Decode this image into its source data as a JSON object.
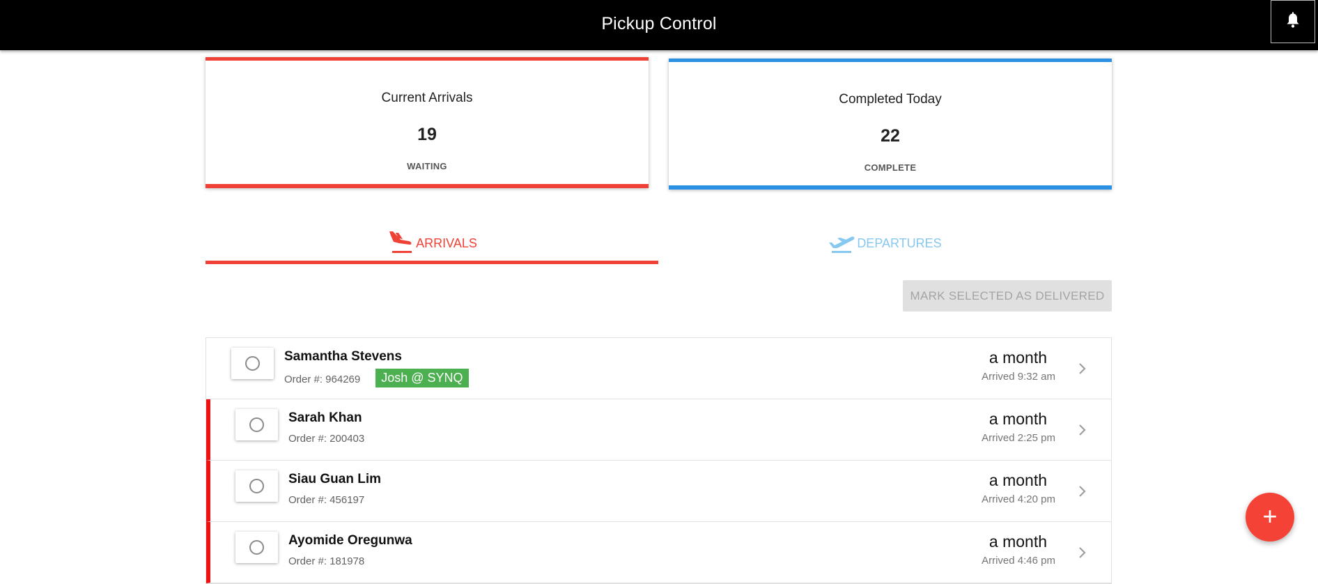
{
  "header": {
    "title": "Pickup Control",
    "notification_icon": "bell-icon"
  },
  "stats": {
    "arrivals": {
      "title": "Current Arrivals",
      "count": "19",
      "status": "WAITING",
      "accent": "#ef4136"
    },
    "completed": {
      "title": "Completed Today",
      "count": "22",
      "status": "COMPLETE",
      "accent": "#2b8fe2"
    }
  },
  "tabs": {
    "arrivals": {
      "label": "ARRIVALS",
      "icon": "plane-landing-icon",
      "active": true,
      "color": "#ef4136"
    },
    "departures": {
      "label": "DEPARTURES",
      "icon": "plane-takeoff-icon",
      "active": false,
      "color": "#86c8ef"
    }
  },
  "actions": {
    "mark_delivered_label": "MARK SELECTED AS DELIVERED",
    "add_icon": "plus-icon"
  },
  "orders": [
    {
      "name": "Samantha Stevens",
      "order": "Order #: 964269",
      "tag": "Josh @ SYNQ",
      "time_ago": "a month",
      "arrived": "Arrived 9:32 am",
      "flagged": false
    },
    {
      "name": "Sarah Khan",
      "order": "Order #: 200403",
      "tag": "",
      "time_ago": "a month",
      "arrived": "Arrived 2:25 pm",
      "flagged": true
    },
    {
      "name": "Siau Guan Lim",
      "order": "Order #: 456197",
      "tag": "",
      "time_ago": "a month",
      "arrived": "Arrived 4:20 pm",
      "flagged": true
    },
    {
      "name": "Ayomide Oregunwa",
      "order": "Order #: 181978",
      "tag": "",
      "time_ago": "a month",
      "arrived": "Arrived 4:46 pm",
      "flagged": true
    }
  ]
}
